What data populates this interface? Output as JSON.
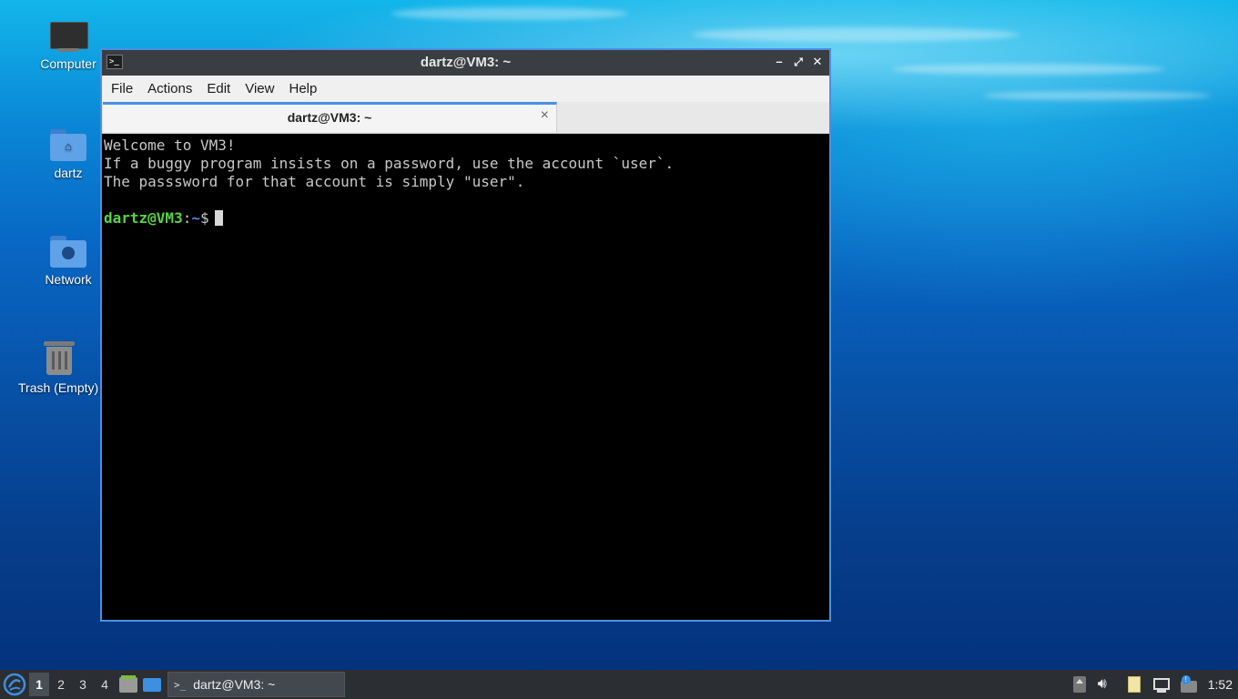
{
  "desktop": {
    "icons": [
      {
        "label": "Computer"
      },
      {
        "label": "dartz"
      },
      {
        "label": "Network"
      },
      {
        "label": "Trash (Empty)"
      }
    ]
  },
  "window": {
    "title": "dartz@VM3: ~",
    "menu": [
      "File",
      "Actions",
      "Edit",
      "View",
      "Help"
    ],
    "tab_label": "dartz@VM3: ~",
    "tab_close": "×"
  },
  "terminal": {
    "lines": [
      "Welcome to VM3!",
      "If a buggy program insists on a password, use the account `user`.",
      "The passsword for that account is simply \"user\".",
      ""
    ],
    "prompt_user": "dartz@VM3",
    "prompt_sep": ":",
    "prompt_path": "~",
    "prompt_symbol": "$"
  },
  "taskbar": {
    "workspaces": [
      "1",
      "2",
      "3",
      "4"
    ],
    "active_workspace": "1",
    "task_label": "dartz@VM3: ~",
    "clock": "1:52"
  },
  "colors": {
    "accent": "#4a90e2",
    "prompt_user": "#55d642",
    "prompt_path": "#5d7fe8"
  }
}
